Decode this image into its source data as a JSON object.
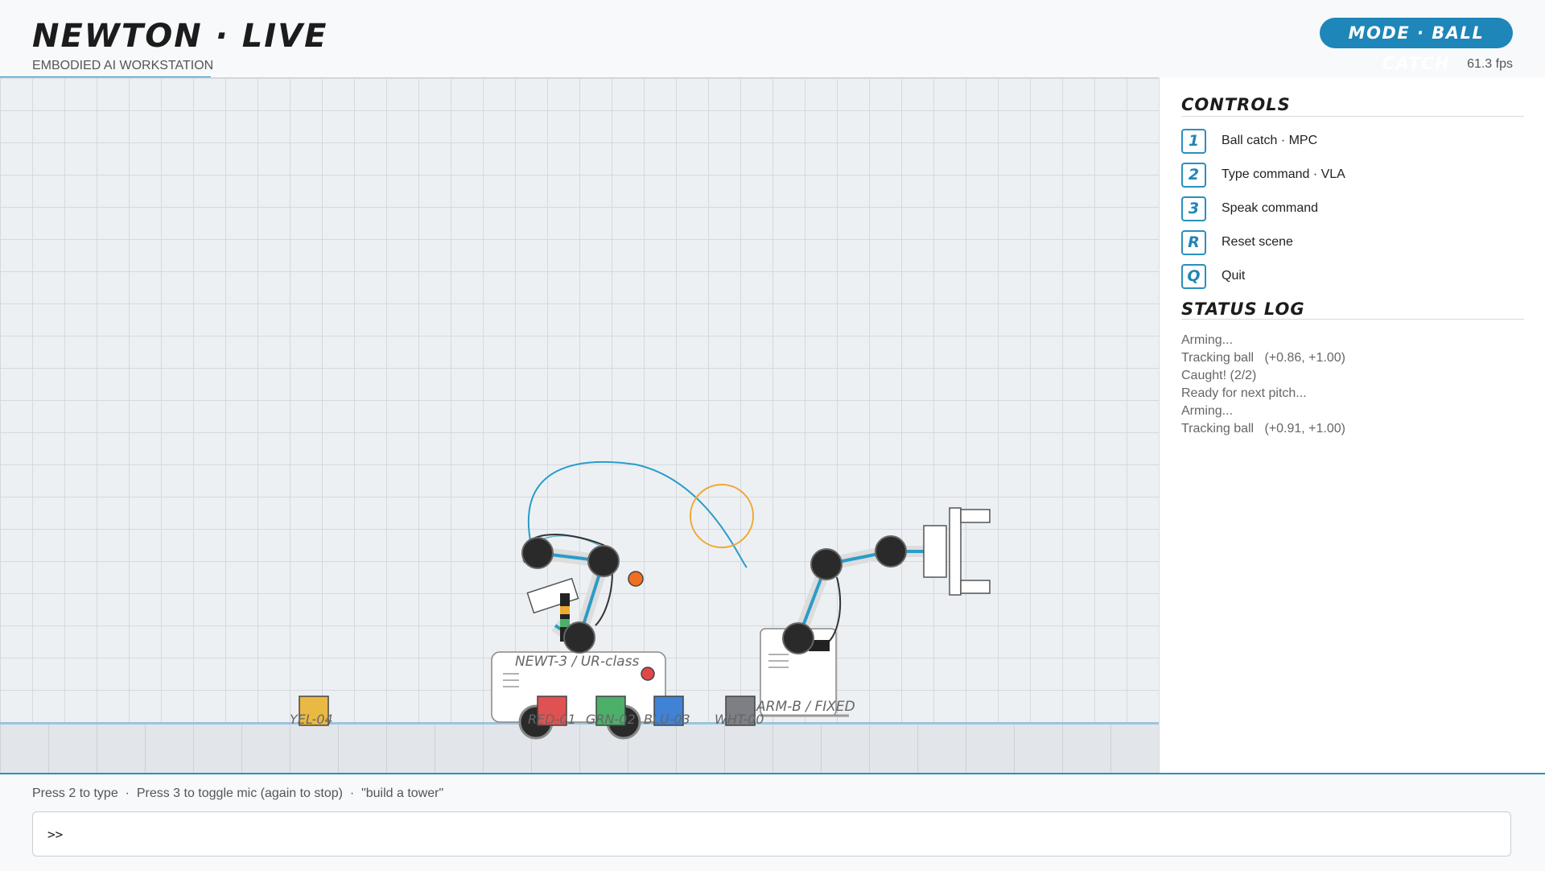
{
  "app": {
    "title": "NEWTON · LIVE",
    "subtitle": "EMBODIED AI WORKSTATION",
    "mode": "MODE · BALL CATCH",
    "fps": "61.3 fps"
  },
  "colors": {
    "accent": "#1e86b8",
    "ball": "#f07020",
    "target_ring": "#f0a830",
    "trajectory": "#2a9cc8"
  },
  "scene": {
    "mobile_robot_label": "NEWT-3 / UR-class",
    "fixed_arm_label": "ARM-B / FIXED",
    "blocks": [
      {
        "label": "YEL-04",
        "color": "#e9b944"
      },
      {
        "label": "RED-01",
        "color": "#e05252"
      },
      {
        "label": "GRN-02",
        "color": "#4caf6a"
      },
      {
        "label": "BLU-03",
        "color": "#3f82d6"
      },
      {
        "label": "WHT-00",
        "color": "#7d7f85"
      }
    ]
  },
  "controls": {
    "title": "CONTROLS",
    "items": [
      {
        "key": "1",
        "label": "Ball catch · MPC"
      },
      {
        "key": "2",
        "label": "Type command · VLA"
      },
      {
        "key": "3",
        "label": "Speak command"
      },
      {
        "key": "R",
        "label": "Reset scene"
      },
      {
        "key": "Q",
        "label": "Quit"
      }
    ]
  },
  "status_log": {
    "title": "STATUS LOG",
    "lines": [
      "Arming...",
      "Tracking ball   (+0.86, +1.00)",
      "Caught! (2/2)",
      "Ready for next pitch...",
      "Arming...",
      "Tracking ball   (+0.91, +1.00)"
    ]
  },
  "command_bar": {
    "hint": "Press 2 to type  ·  Press 3 to toggle mic (again to stop)  ·  \"build a tower\"",
    "prompt": ">>",
    "value": ""
  }
}
